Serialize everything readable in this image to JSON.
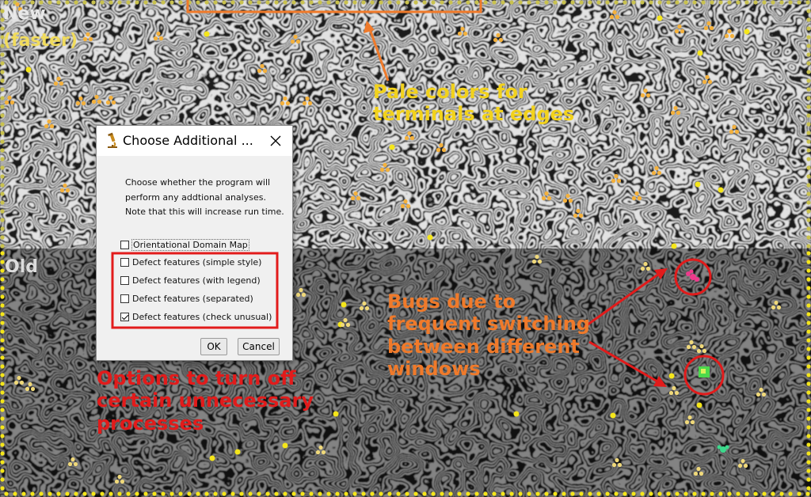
{
  "labels": {
    "new": "New",
    "faster": "(faster)",
    "old": "Old"
  },
  "annotations": {
    "pale_colors": [
      "Pale colors for",
      "terminals at edges"
    ],
    "options": [
      "Options to turn off",
      "certain unnecessary",
      "processes"
    ],
    "bugs": [
      "Bugs due to",
      "frequent switching",
      "between different",
      "windows"
    ]
  },
  "dialog": {
    "title": "Choose Additional ...",
    "description": [
      "Choose whether the program will",
      "perform any addtional analyses.",
      "Note that this will increase run time."
    ],
    "options": [
      {
        "label": "Orientational Domain Map",
        "checked": false
      },
      {
        "label": "Defect features (simple style)",
        "checked": false
      },
      {
        "label": "Defect features (with legend)",
        "checked": false
      },
      {
        "label": "Defect features (separated)",
        "checked": false
      },
      {
        "label": "Defect features (check unusual)",
        "checked": true
      }
    ],
    "ok_label": "OK",
    "cancel_label": "Cancel"
  },
  "colors": {
    "annotation_orange": "#f07a2a",
    "annotation_red": "#e21b1b",
    "annotation_yellow": "#f2d21c",
    "terminal_yellow": "#f5e61a",
    "pale_terminal": "#c9c24e",
    "junction_orange": "#f4b13c",
    "junction_pale": "#f0d97a",
    "bug_pink": "#ee3a8c",
    "bug_green": "#4cd94c"
  },
  "icons": {
    "app": "microscope-icon",
    "close": "close-icon"
  }
}
